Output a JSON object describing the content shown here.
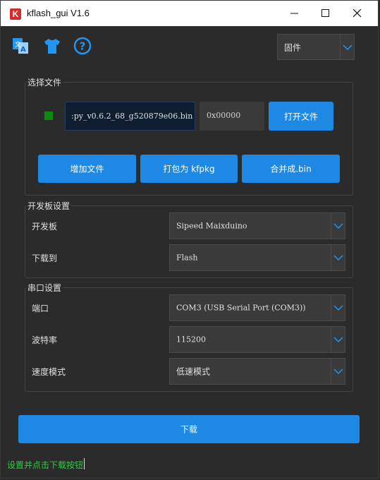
{
  "window": {
    "title": "kflash_gui V1.6",
    "logo_letter": "K"
  },
  "toolbar": {
    "icons": [
      "translate-icon",
      "theme-shirt-icon",
      "help-icon"
    ],
    "mode_select": "固件"
  },
  "file_group": {
    "title": "选择文件",
    "file_path": ":py_v0.6.2_68_g520879e06.bin",
    "address": "0x00000",
    "open_button": "打开文件",
    "add_button": "增加文件",
    "pack_button": "打包为 kfpkg",
    "merge_button": "合并成.bin",
    "enabled_color": "#0e8a0e"
  },
  "board_group": {
    "title": "开发板设置",
    "board_label": "开发板",
    "board_value": "Sipeed Maixduino",
    "target_label": "下载到",
    "target_value": "Flash"
  },
  "serial_group": {
    "title": "串口设置",
    "port_label": "端口",
    "port_value": "COM3 (USB Serial Port (COM3))",
    "baud_label": "波特率",
    "baud_value": "115200",
    "speed_label": "速度模式",
    "speed_value": "低速模式"
  },
  "download_button": "下载",
  "status_text": "设置并点击下载按钮",
  "colors": {
    "accent": "#1e88e5",
    "status": "#2ecc40",
    "background": "#2b2b2b"
  }
}
